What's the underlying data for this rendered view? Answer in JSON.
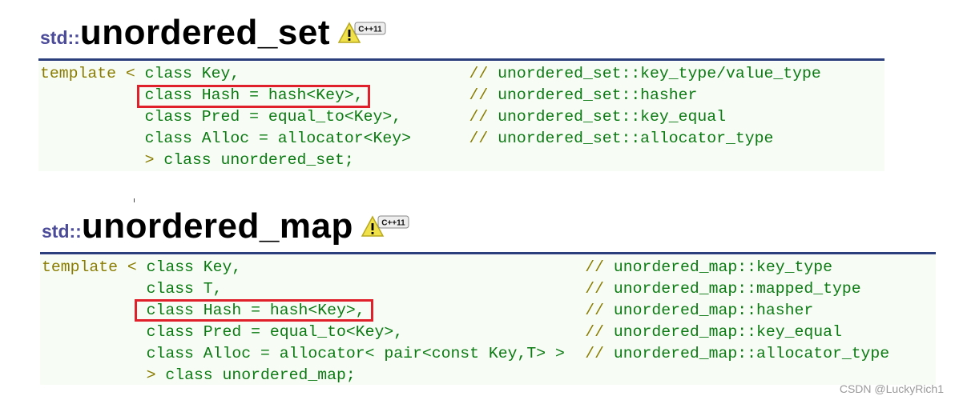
{
  "sections": [
    {
      "scope": "std::",
      "name": "unordered_set",
      "badge": "C++11",
      "lines": [
        {
          "prefix": "template < ",
          "code": "class Key,",
          "comment": "unordered_set::key_type/value_type"
        },
        {
          "prefix": "",
          "code": "class Hash = hash<Key>,",
          "comment": "unordered_set::hasher"
        },
        {
          "prefix": "",
          "code": "class Pred = equal_to<Key>,",
          "comment": "unordered_set::key_equal"
        },
        {
          "prefix": "",
          "code": "class Alloc = allocator<Key>",
          "comment": "unordered_set::allocator_type"
        },
        {
          "prefix": "",
          "code": "> class unordered_set;",
          "comment": ""
        }
      ]
    },
    {
      "scope": "std::",
      "name": "unordered_map",
      "badge": "C++11",
      "lines": [
        {
          "prefix": "template < ",
          "code": "class Key,",
          "comment": "unordered_map::key_type"
        },
        {
          "prefix": "",
          "code": "class T,",
          "comment": "unordered_map::mapped_type"
        },
        {
          "prefix": "",
          "code": "class Hash = hash<Key>,",
          "comment": "unordered_map::hasher"
        },
        {
          "prefix": "",
          "code": "class Pred = equal_to<Key>,",
          "comment": "unordered_map::key_equal"
        },
        {
          "prefix": "",
          "code": "class Alloc = allocator< pair<const Key,T> >",
          "comment": "unordered_map::allocator_type"
        },
        {
          "prefix": "",
          "code": "> class unordered_map;",
          "comment": ""
        }
      ]
    }
  ],
  "comment_marker": "// ",
  "highlight_color": "#e0202a",
  "watermark": "CSDN @LuckyRich1"
}
